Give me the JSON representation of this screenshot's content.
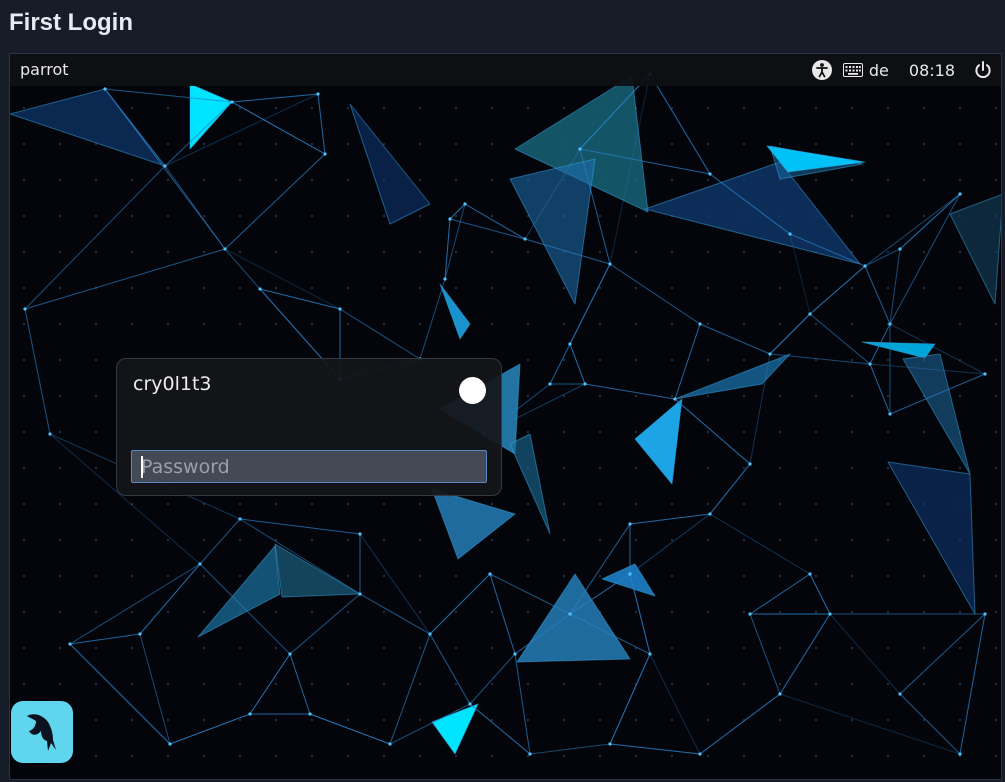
{
  "page": {
    "title": "First Login"
  },
  "topbar": {
    "hostname": "parrot",
    "keyboard_layout": "de",
    "clock": "08:18",
    "icons": {
      "accessibility": "accessibility-icon",
      "keyboard": "keyboard-icon",
      "power": "power-icon"
    }
  },
  "login": {
    "username": "cry0l1t3",
    "password_placeholder": "Password",
    "password_value": "",
    "status_indicator_color": "#ffffff"
  },
  "dock": {
    "icon": "parrot-logo-icon"
  },
  "colors": {
    "background": "#03050b",
    "accent_cyan": "#00e5ff",
    "accent_blue": "#1e7fd0",
    "frame": "#161d29"
  }
}
